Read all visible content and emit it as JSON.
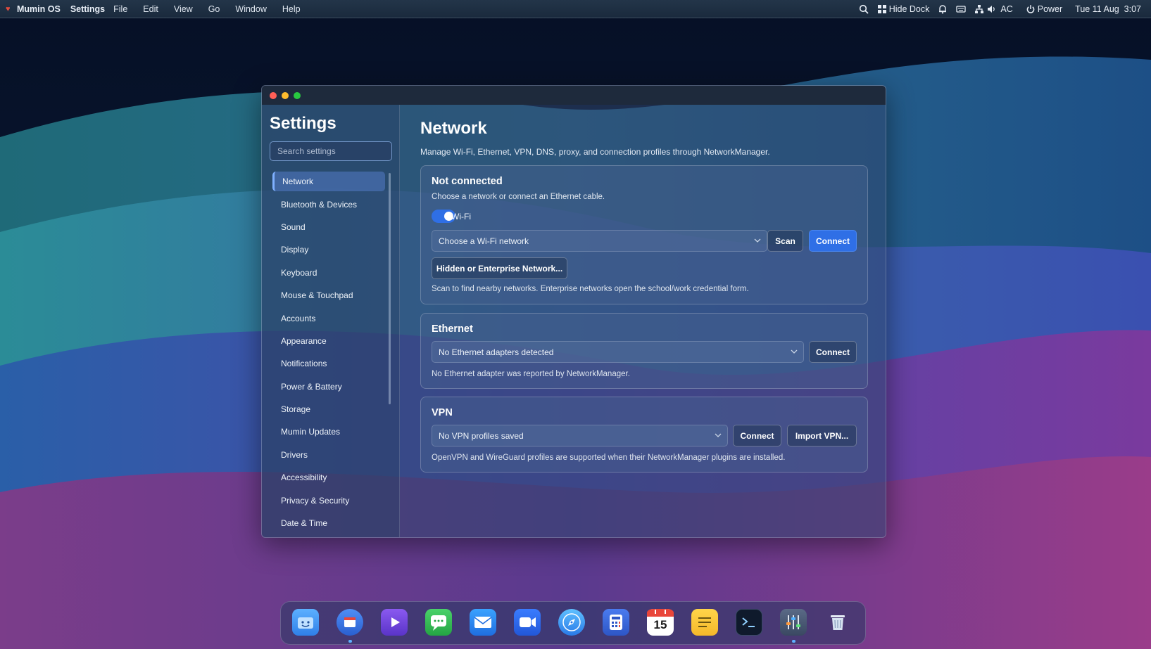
{
  "menubar": {
    "os_name": "Mumin OS",
    "app_name": "Settings",
    "menus": [
      "File",
      "Edit",
      "View",
      "Go",
      "Window",
      "Help"
    ],
    "hide_dock": "Hide Dock",
    "ac": "AC",
    "power": "Power",
    "datetime": "Tue 11 Aug  3:07"
  },
  "sidebar": {
    "title": "Settings",
    "search_placeholder": "Search settings",
    "items": [
      {
        "label": "Network",
        "active": true
      },
      {
        "label": "Bluetooth & Devices"
      },
      {
        "label": "Sound"
      },
      {
        "label": "Display"
      },
      {
        "label": "Keyboard"
      },
      {
        "label": "Mouse & Touchpad"
      },
      {
        "label": "Accounts"
      },
      {
        "label": "Appearance"
      },
      {
        "label": "Notifications"
      },
      {
        "label": "Power & Battery"
      },
      {
        "label": "Storage"
      },
      {
        "label": "Mumin Updates"
      },
      {
        "label": "Drivers"
      },
      {
        "label": "Accessibility"
      },
      {
        "label": "Privacy & Security"
      },
      {
        "label": "Date & Time"
      }
    ]
  },
  "main": {
    "title": "Network",
    "subtitle": "Manage Wi-Fi, Ethernet, VPN, DNS, proxy, and connection profiles through NetworkManager.",
    "wifi": {
      "title": "Not connected",
      "description": "Choose a network or connect an Ethernet cable.",
      "toggle_label": "Wi-Fi",
      "toggle_on": true,
      "select_value": "Choose a Wi-Fi network",
      "scan_label": "Scan",
      "connect_label": "Connect",
      "hidden_label": "Hidden or Enterprise Network...",
      "hint": "Scan to find nearby networks. Enterprise networks open the school/work credential form."
    },
    "ethernet": {
      "title": "Ethernet",
      "select_value": "No Ethernet adapters detected",
      "connect_label": "Connect",
      "hint": "No Ethernet adapter was reported by NetworkManager."
    },
    "vpn": {
      "title": "VPN",
      "select_value": "No VPN profiles saved",
      "connect_label": "Connect",
      "import_label": "Import VPN...",
      "hint": "OpenVPN and WireGuard profiles are supported when their NetworkManager plugins are installed."
    }
  },
  "dock": {
    "items": [
      {
        "icon": "finder-icon",
        "running": false
      },
      {
        "icon": "app-store-icon",
        "running": true
      },
      {
        "icon": "video-player-icon",
        "running": false
      },
      {
        "icon": "messages-icon",
        "running": false
      },
      {
        "icon": "mail-icon",
        "running": false
      },
      {
        "icon": "video-call-icon",
        "running": false
      },
      {
        "icon": "browser-compass-icon",
        "running": false
      },
      {
        "icon": "calculator-icon",
        "running": false
      },
      {
        "icon": "calendar-icon",
        "running": false,
        "badge": "15"
      },
      {
        "icon": "notes-icon",
        "running": false
      },
      {
        "icon": "terminal-icon",
        "running": false
      },
      {
        "icon": "settings-sliders-icon",
        "running": true
      },
      {
        "icon": "trash-icon",
        "running": false
      }
    ]
  },
  "colors": {
    "accent": "#2f6fe6",
    "close": "#ff5f57",
    "minimize": "#febc2e",
    "maximize": "#28c840"
  }
}
